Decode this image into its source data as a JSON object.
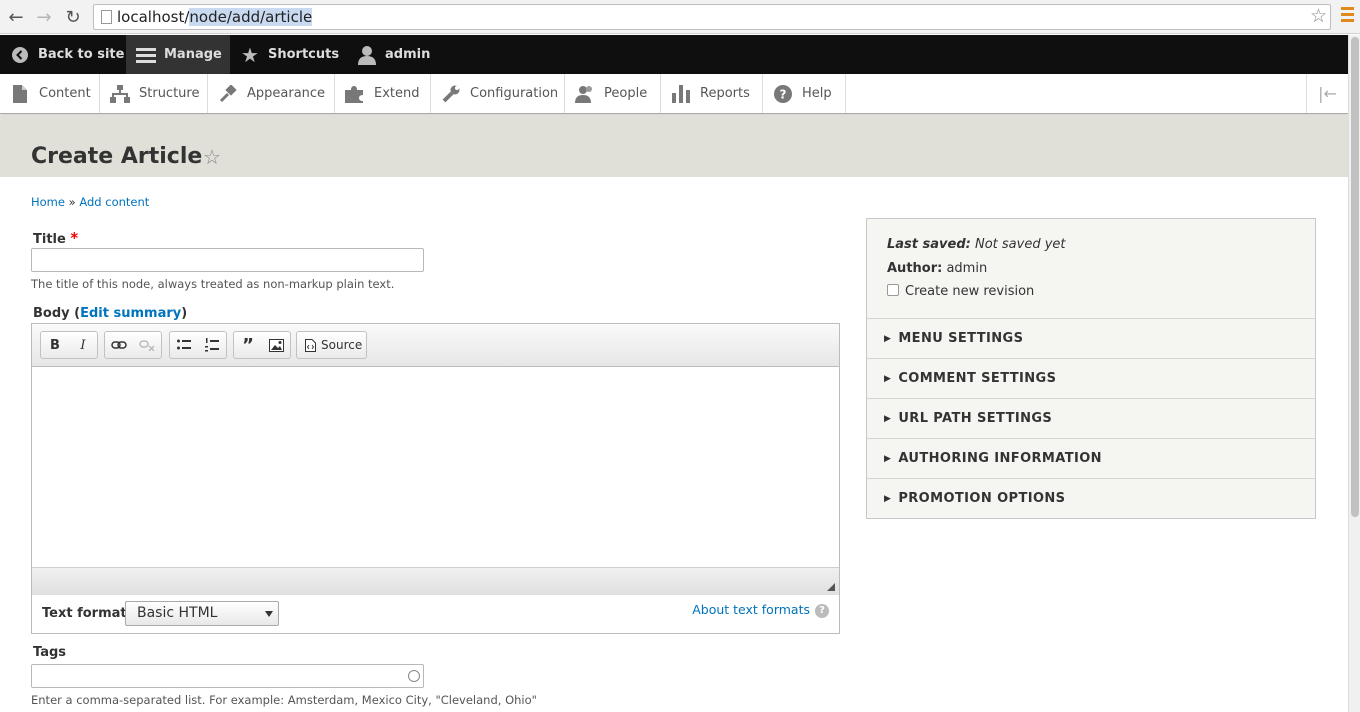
{
  "browser": {
    "url_host": "localhost/",
    "url_path": "node/add/article"
  },
  "toolbar": {
    "back_to_site": "Back to site",
    "manage": "Manage",
    "shortcuts": "Shortcuts",
    "user": "admin"
  },
  "tray": {
    "items": [
      "Content",
      "Structure",
      "Appearance",
      "Extend",
      "Configuration",
      "People",
      "Reports",
      "Help"
    ]
  },
  "page": {
    "title": "Create Article",
    "breadcrumb": {
      "home": "Home",
      "separator": "»",
      "add_content": "Add content"
    }
  },
  "form": {
    "title_label": "Title",
    "required_mark": "*",
    "title_value": "",
    "title_description": "The title of this node, always treated as non-markup plain text.",
    "body_label": "Body",
    "body_open_paren": "(",
    "edit_summary": "Edit summary",
    "body_close_paren": ")",
    "editor_buttons": {
      "bold": "B",
      "italic": "I",
      "source": "Source"
    },
    "text_format_label": "Text format",
    "text_format_value": "Basic HTML",
    "about_text_formats": "About text formats",
    "help_glyph": "?",
    "tags_label": "Tags",
    "tags_value": "",
    "tags_description": "Enter a comma-separated list. For example: Amsterdam, Mexico City, \"Cleveland, Ohio\""
  },
  "sidebar": {
    "last_saved_label": "Last saved:",
    "last_saved_value": "Not saved yet",
    "author_label": "Author:",
    "author_value": "admin",
    "create_revision_label": "Create new revision",
    "sections": [
      "MENU SETTINGS",
      "COMMENT SETTINGS",
      "URL PATH SETTINGS",
      "AUTHORING INFORMATION",
      "PROMOTION OPTIONS"
    ]
  },
  "colors": {
    "link": "#0074bd",
    "toolbar_bg": "#0f0f0f",
    "header_bg": "#e0e0d8",
    "required": "#ee0000"
  }
}
